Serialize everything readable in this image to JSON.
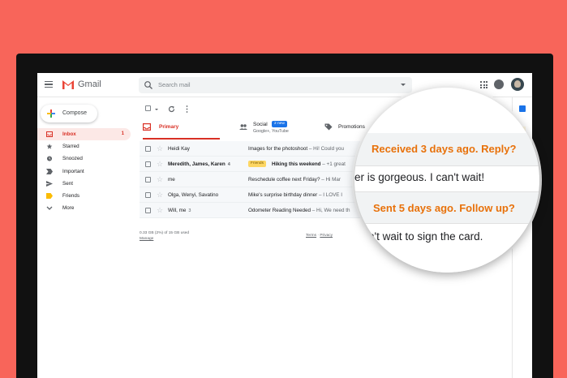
{
  "app": {
    "name": "Gmail"
  },
  "search": {
    "placeholder": "Search mail"
  },
  "sidebar": {
    "compose_label": "Compose",
    "items": [
      {
        "label": "Inbox",
        "count": "1",
        "icon": "inbox-icon"
      },
      {
        "label": "Starred",
        "icon": "star-icon"
      },
      {
        "label": "Snoozed",
        "icon": "clock-icon"
      },
      {
        "label": "Important",
        "icon": "important-icon"
      },
      {
        "label": "Sent",
        "icon": "send-icon"
      },
      {
        "label": "Friends",
        "icon": "label-icon"
      },
      {
        "label": "More",
        "icon": "chevron-down-icon"
      }
    ]
  },
  "tabs": {
    "primary": "Primary",
    "social": "Social",
    "social_badge": "2 new",
    "social_sub": "Google+, YouTube",
    "promotions": "Promotions"
  },
  "mails": [
    {
      "sender": "Heidi Kay",
      "count": "",
      "label": "",
      "subject": "Images for the photoshoot",
      "snippet": " – Hi! Could you",
      "unread": false
    },
    {
      "sender": "Meredith, James, Karen",
      "count": "4",
      "label": "Friends",
      "subject": "Hiking this weekend",
      "snippet": " – +1 great",
      "unread": true
    },
    {
      "sender": "me",
      "count": "",
      "label": "",
      "subject": "Reschedule coffee next Friday?",
      "snippet": " – Hi Mar",
      "unread": false
    },
    {
      "sender": "Olga, Wenyi, Savatino",
      "count": "",
      "label": "",
      "subject": "Mike's surprise birthday dinner",
      "snippet": " – I LOVE I",
      "unread": false
    },
    {
      "sender": "Will, me",
      "count": "3",
      "label": "",
      "subject": "Odometer Reading Needed",
      "snippet": " – Hi, We need th",
      "unread": false
    }
  ],
  "footer": {
    "storage": "0.33 GB (2%) of 15 GB used",
    "manage": "Manage",
    "terms": "Terms",
    "sep": " · ",
    "privacy": "Privacy"
  },
  "magnifier": {
    "reminder_received": "Received 3 days ago. Reply?",
    "body_line_1": "er is gorgeous.  I can't wait!",
    "reminder_sent": "Sent 5 days ago. Follow up?",
    "body_line_2": "n't wait to sign the card."
  },
  "colors": {
    "background": "#f8655a",
    "accent_red": "#d93025",
    "nudge_orange": "#e8710a",
    "badge_blue": "#1a73e8"
  }
}
